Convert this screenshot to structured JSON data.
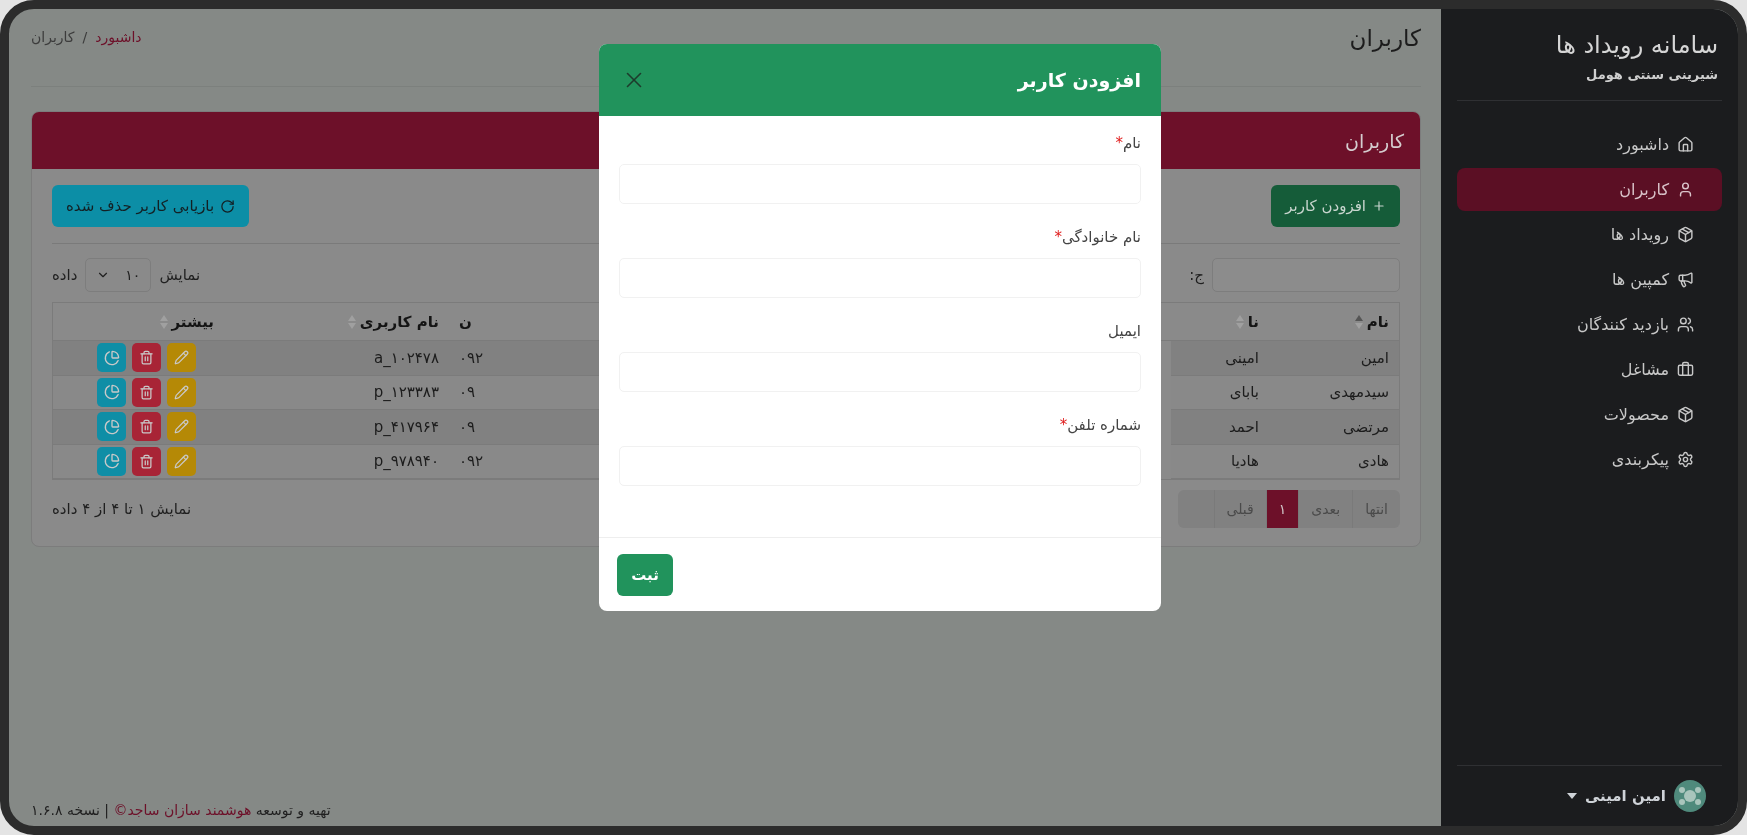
{
  "sidebar": {
    "title": "سامانه رویداد ها",
    "subtitle": "شیرینی سنتی هومل",
    "items": [
      {
        "label": "داشبورد",
        "selected": false
      },
      {
        "label": "کاربران",
        "selected": true
      },
      {
        "label": "رویداد ها",
        "selected": false
      },
      {
        "label": "کمپین ها",
        "selected": false
      },
      {
        "label": "بازدید کنندگان",
        "selected": false
      },
      {
        "label": "مشاغل",
        "selected": false
      },
      {
        "label": "محصولات",
        "selected": false
      },
      {
        "label": "پیکربندی",
        "selected": false
      }
    ],
    "user": {
      "name": "امین امینی"
    }
  },
  "page_title": "کاربران",
  "breadcrumb": {
    "items": [
      {
        "label": "داشبورد",
        "link": true
      },
      {
        "label": "کاربران",
        "link": false
      }
    ],
    "separator": "/"
  },
  "card": {
    "title": "کاربران",
    "add_button": "افزودن کاربر",
    "restore_button": "بازیابی کاربر حذف شده"
  },
  "table_controls": {
    "search_label": "ج:",
    "length_before": "نمایش",
    "length_value": "۱۰",
    "length_after": "داده"
  },
  "table": {
    "columns": [
      {
        "label": "نام",
        "sorted": true
      },
      {
        "label": "نا",
        "sorted": false
      },
      {
        "label": "ن"
      },
      {
        "label": "نام کاربری",
        "sorted": false
      },
      {
        "label": "بیشتر",
        "sorted": false
      }
    ],
    "rows": [
      {
        "first": "امین",
        "last": "امینی",
        "phone": "۰۹۲",
        "username": "a_۱۰۲۴۷۸"
      },
      {
        "first": "سیدمهدی",
        "last": "بابای",
        "phone": "۰۹",
        "username": "p_۱۲۳۳۸۳"
      },
      {
        "first": "مرتضی",
        "last": "احمد",
        "phone": "۰۹",
        "username": "p_۴۱۷۹۶۴"
      },
      {
        "first": "هادی",
        "last": "هادیا",
        "phone": "۰۹۲",
        "username": "p_۹۷۸۹۴۰"
      }
    ]
  },
  "info": "نمایش ۱ تا ۴ از ۴ داده",
  "pagination": [
    {
      "label": "انتها",
      "selected": false
    },
    {
      "label": "بعدی",
      "selected": false
    },
    {
      "label": "۱",
      "selected": true
    },
    {
      "label": "قبلی",
      "selected": false
    }
  ],
  "footer": {
    "before": "تهیه و توسعه",
    "link": "هوشمند سازان ساجد©",
    "after": "| نسخه ۱.۶.۸"
  },
  "modal": {
    "title": "افزودن کاربر",
    "required_mark": "*",
    "fields": [
      {
        "label": "نام",
        "required": true
      },
      {
        "label": "نام خانوادگی",
        "required": true
      },
      {
        "label": "ایمیل",
        "required": false
      },
      {
        "label": "شماره تلفن",
        "required": true
      }
    ],
    "submit": "ثبت"
  }
}
